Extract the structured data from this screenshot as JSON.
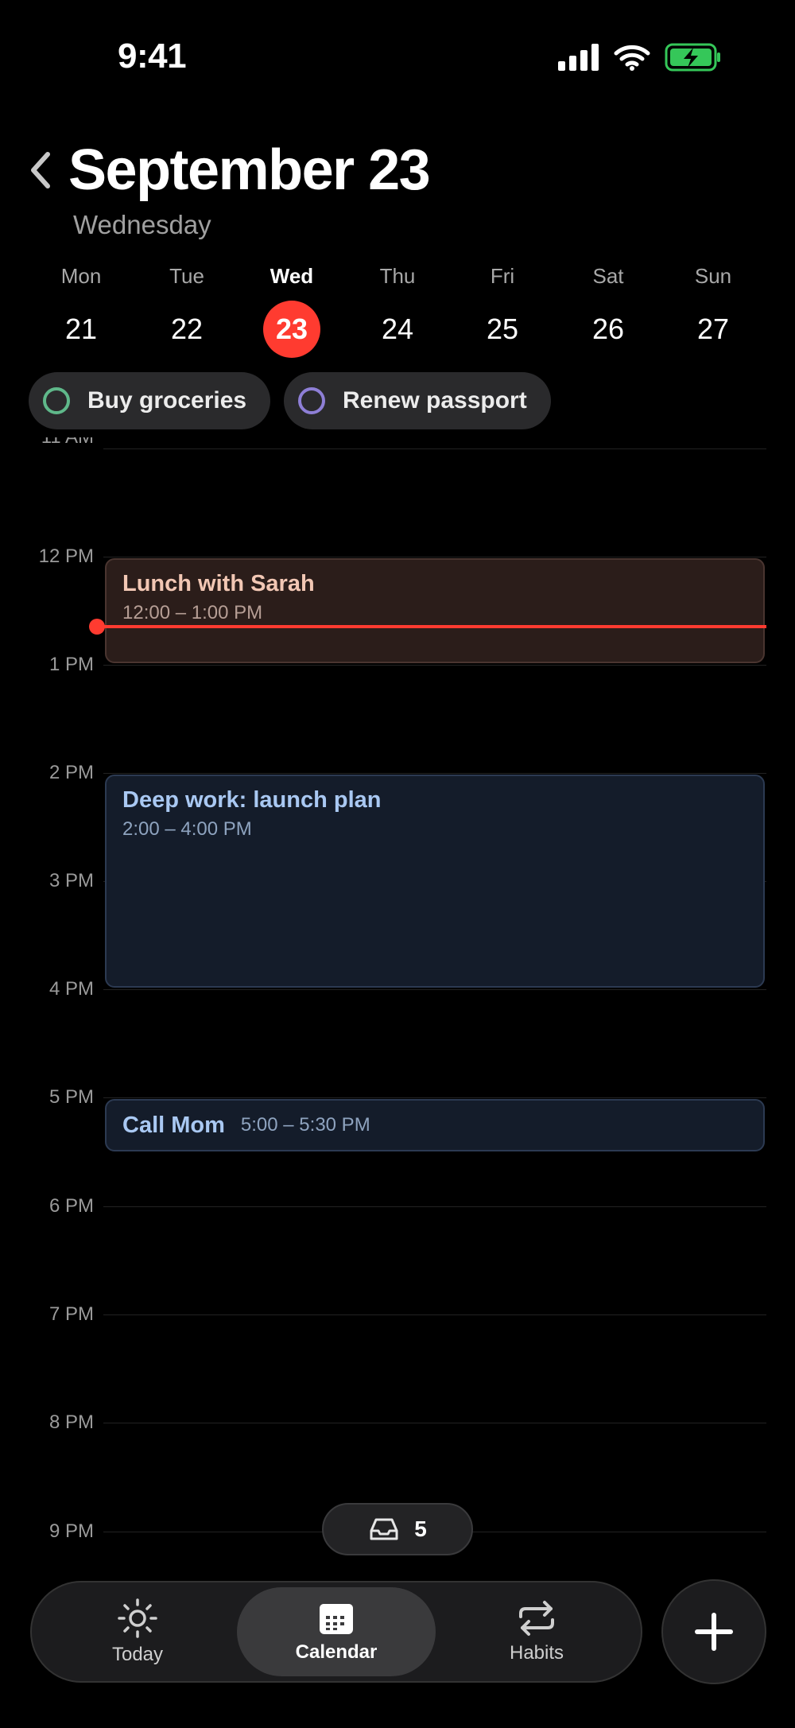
{
  "status_bar": {
    "time": "9:41"
  },
  "header": {
    "title": "September 23",
    "subtitle": "Wednesday"
  },
  "week": [
    {
      "name": "Mon",
      "num": "21",
      "selected": false
    },
    {
      "name": "Tue",
      "num": "22",
      "selected": false
    },
    {
      "name": "Wed",
      "num": "23",
      "selected": true
    },
    {
      "name": "Thu",
      "num": "24",
      "selected": false
    },
    {
      "name": "Fri",
      "num": "25",
      "selected": false
    },
    {
      "name": "Sat",
      "num": "26",
      "selected": false
    },
    {
      "name": "Sun",
      "num": "27",
      "selected": false
    }
  ],
  "tasks": [
    {
      "label": "Buy groceries",
      "ring_color": "#5fb88a"
    },
    {
      "label": "Renew passport",
      "ring_color": "#8e7fd6"
    }
  ],
  "timeline": {
    "hours": [
      "11 AM",
      "12 PM",
      "1 PM",
      "2 PM",
      "3 PM",
      "4 PM",
      "5 PM",
      "6 PM",
      "7 PM",
      "8 PM",
      "9 PM"
    ],
    "events": [
      {
        "title": "Lunch with Sarah",
        "time": "12:00 – 1:00 PM"
      },
      {
        "title": "Deep work: launch plan",
        "time": "2:00 – 4:00 PM"
      },
      {
        "title": "Call Mom",
        "time": "5:00 – 5:30 PM"
      }
    ],
    "now_color": "#ff3b30"
  },
  "inbox": {
    "count": "5",
    "icon": "inbox-tray-icon"
  },
  "tabbar": {
    "tabs": [
      {
        "label": "Today",
        "icon": "sun-icon"
      },
      {
        "label": "Calendar",
        "icon": "calendar-icon",
        "active": true
      },
      {
        "label": "Habits",
        "icon": "repeat-icon"
      }
    ],
    "add_icon": "plus-icon"
  },
  "colors": {
    "accent": "#ff3b30",
    "lunch_bg": "#2b1d1a",
    "work_bg": "#141c2a"
  }
}
